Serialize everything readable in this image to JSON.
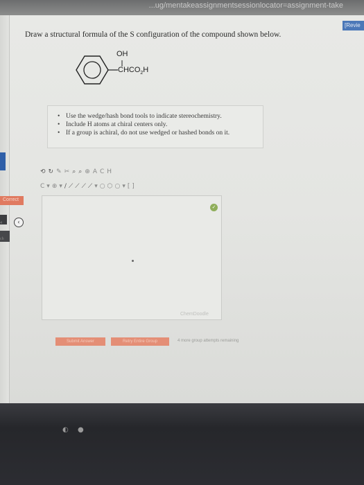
{
  "browser": {
    "title_fragment": "...ug/mentakeassignmentsessionlocator=assignment-take"
  },
  "header": {
    "review_label": "[Revie"
  },
  "sidebar": {
    "status_tab": "Correct",
    "nav_icon": "back-arrow-icon",
    "tab_labels": [
      "4",
      "ch"
    ]
  },
  "question": {
    "prompt": "Draw a structural formula of the S configuration of the compound shown below.",
    "molecule": {
      "top_label": "OH",
      "side_label": "CHCO",
      "subscript": "2",
      "suffix": "H"
    }
  },
  "hints": [
    "Use the wedge/hash bond tools to indicate stereochemistry.",
    "Include H atoms at chiral centers only.",
    "If a group is achiral, do not use wedged or hashed bonds on it."
  ],
  "editor": {
    "toolbar1": [
      "⟲",
      "↻",
      "✎",
      "✂",
      "⌕",
      "⌕",
      "⊕",
      "A",
      "C",
      "H"
    ],
    "toolbar2": [
      "C",
      "▾",
      "⊕",
      "▾",
      "/",
      "⟋",
      "⟋",
      "⟋",
      "⟋",
      "▾",
      "○",
      "⬡",
      "○",
      "▾",
      "[ ]"
    ],
    "watermark": "ChemDoodle",
    "check_icon": "check-circle-icon"
  },
  "actions": {
    "submit_label": "Submit Answer",
    "retry_label": "Retry Entire Group",
    "attempts_text": "4 more group attempts remaining"
  },
  "colors": {
    "accent_button": "#e48e76",
    "review_blue": "#4b78b8",
    "correct_tab": "#e07a60"
  }
}
